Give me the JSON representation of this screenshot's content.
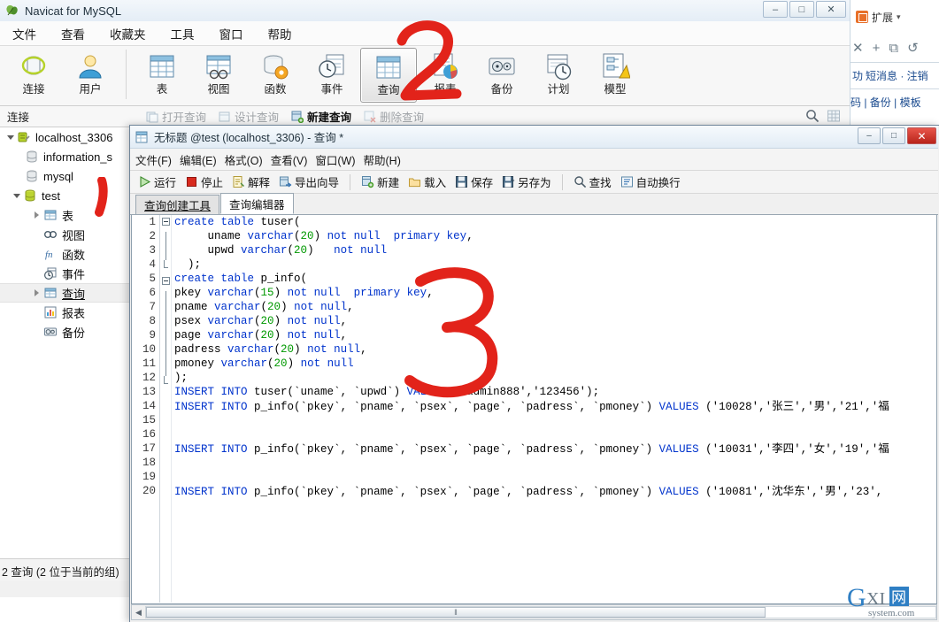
{
  "main_window": {
    "title": "Navicat for MySQL",
    "title_icon": "navicat-logo-icon",
    "window_buttons": {
      "minimize": "–",
      "maximize": "□",
      "close": "✕"
    },
    "menu": [
      {
        "label": "文件"
      },
      {
        "label": "查看"
      },
      {
        "label": "收藏夹"
      },
      {
        "label": "工具"
      },
      {
        "label": "窗口"
      },
      {
        "label": "帮助"
      }
    ],
    "toolbar": {
      "group1": [
        {
          "label": "连接",
          "icon": "connection-icon",
          "selected": false
        },
        {
          "label": "用户",
          "icon": "user-icon",
          "selected": false
        }
      ],
      "group2": [
        {
          "label": "表",
          "icon": "table-icon",
          "selected": false
        },
        {
          "label": "视图",
          "icon": "view-icon",
          "selected": false
        },
        {
          "label": "函数",
          "icon": "function-icon",
          "selected": false
        },
        {
          "label": "事件",
          "icon": "event-icon",
          "selected": false
        },
        {
          "label": "查询",
          "icon": "query-icon",
          "selected": true
        },
        {
          "label": "报表",
          "icon": "report-icon",
          "selected": false
        },
        {
          "label": "备份",
          "icon": "backup-icon",
          "selected": false
        },
        {
          "label": "计划",
          "icon": "schedule-icon",
          "selected": false
        },
        {
          "label": "模型",
          "icon": "model-icon",
          "selected": false
        }
      ]
    },
    "connection_bar": {
      "label": "连接",
      "actions": [
        {
          "label": "打开查询",
          "icon": "open-query-icon",
          "enabled": false
        },
        {
          "label": "设计查询",
          "icon": "design-query-icon",
          "enabled": false
        },
        {
          "label": "新建查询",
          "icon": "new-query-icon",
          "enabled": true
        },
        {
          "label": "删除查询",
          "icon": "delete-query-icon",
          "enabled": false
        }
      ],
      "right_icons": [
        {
          "name": "search-icon"
        },
        {
          "name": "grid-view-icon"
        }
      ]
    },
    "sidebar": {
      "items": [
        {
          "label": "localhost_3306",
          "icon": "server-icon",
          "indent": 0,
          "twisty": "open",
          "selected": false
        },
        {
          "label": "information_s",
          "icon": "database-gray-icon",
          "indent": 1,
          "twisty": "none",
          "selected": false
        },
        {
          "label": "mysql",
          "icon": "database-gray-icon",
          "indent": 1,
          "twisty": "none",
          "selected": false
        },
        {
          "label": "test",
          "icon": "database-green-icon",
          "indent": 0,
          "twisty": "open",
          "selected": false
        },
        {
          "label": "表",
          "icon": "table-icon",
          "indent": 2,
          "twisty": "closed",
          "selected": false
        },
        {
          "label": "视图",
          "icon": "view-icon",
          "indent": 2,
          "twisty": "none",
          "selected": false
        },
        {
          "label": "函数",
          "icon": "function-icon",
          "indent": 2,
          "twisty": "none",
          "selected": false
        },
        {
          "label": "事件",
          "icon": "event-icon",
          "indent": 2,
          "twisty": "none",
          "selected": false
        },
        {
          "label": "查询",
          "icon": "query-icon",
          "indent": 2,
          "twisty": "closed",
          "selected": true
        },
        {
          "label": "报表",
          "icon": "report-icon",
          "indent": 2,
          "twisty": "none",
          "selected": false
        },
        {
          "label": "备份",
          "icon": "backup-icon",
          "indent": 2,
          "twisty": "none",
          "selected": false
        }
      ]
    },
    "status_bar": {
      "text": "2 查询 (2 位于当前的组)"
    }
  },
  "query_window": {
    "title": "无标题 @test (localhost_3306) - 查询 *",
    "title_icon": "query-document-icon",
    "window_buttons": {
      "minimize": "–",
      "maximize": "□",
      "close": "✕"
    },
    "menu": [
      {
        "label": "文件(F)"
      },
      {
        "label": "编辑(E)"
      },
      {
        "label": "格式(O)"
      },
      {
        "label": "查看(V)"
      },
      {
        "label": "窗口(W)"
      },
      {
        "label": "帮助(H)"
      }
    ],
    "toolbar": [
      {
        "label": "运行",
        "icon": "run-icon"
      },
      {
        "label": "停止",
        "icon": "stop-icon"
      },
      {
        "label": "解释",
        "icon": "explain-icon"
      },
      {
        "label": "导出向导",
        "icon": "export-wizard-icon"
      },
      {
        "divider": true
      },
      {
        "label": "新建",
        "icon": "new-icon"
      },
      {
        "label": "载入",
        "icon": "load-icon"
      },
      {
        "label": "保存",
        "icon": "save-icon"
      },
      {
        "label": "另存为",
        "icon": "save-as-icon"
      },
      {
        "divider": true
      },
      {
        "label": "查找",
        "icon": "find-icon"
      },
      {
        "label": "自动换行",
        "icon": "word-wrap-icon"
      }
    ],
    "tabs": [
      {
        "label": "查询创建工具",
        "active": false
      },
      {
        "label": "查询编辑器",
        "active": true
      }
    ],
    "editor": {
      "lines": [
        {
          "n": 1,
          "fold": "start",
          "text": "create table tuser("
        },
        {
          "n": 2,
          "fold": "body",
          "text": "     uname varchar(20) not null  primary key,"
        },
        {
          "n": 3,
          "fold": "body",
          "text": "     upwd varchar(20)   not null"
        },
        {
          "n": 4,
          "fold": "end",
          "text": "  );"
        },
        {
          "n": 5,
          "fold": "start",
          "text": "create table p_info("
        },
        {
          "n": 6,
          "fold": "body",
          "text": "pkey varchar(15) not null  primary key,"
        },
        {
          "n": 7,
          "fold": "body",
          "text": "pname varchar(20) not null,"
        },
        {
          "n": 8,
          "fold": "body",
          "text": "psex varchar(20) not null,"
        },
        {
          "n": 9,
          "fold": "body",
          "text": "page varchar(20) not null,"
        },
        {
          "n": 10,
          "fold": "body",
          "text": "padress varchar(20) not null,"
        },
        {
          "n": 11,
          "fold": "body",
          "text": "pmoney varchar(20) not null"
        },
        {
          "n": 12,
          "fold": "end",
          "text": ");"
        },
        {
          "n": 13,
          "fold": "none",
          "text": "INSERT INTO tuser(`uname`, `upwd`) VALUES ('admin888','123456');"
        },
        {
          "n": 14,
          "fold": "none",
          "text": "INSERT INTO p_info(`pkey`, `pname`, `psex`, `page`, `padress`, `pmoney`) VALUES ('10028','张三','男','21','福"
        },
        {
          "n": 15,
          "fold": "none",
          "text": ""
        },
        {
          "n": 16,
          "fold": "none",
          "text": ""
        },
        {
          "n": 17,
          "fold": "none",
          "text": "INSERT INTO p_info(`pkey`, `pname`, `psex`, `page`, `padress`, `pmoney`) VALUES ('10031','李四','女','19','福"
        },
        {
          "n": 18,
          "fold": "none",
          "text": ""
        },
        {
          "n": 19,
          "fold": "none",
          "text": ""
        },
        {
          "n": 20,
          "fold": "none",
          "text": "INSERT INTO p_info(`pkey`, `pname`, `psex`, `page`, `padress`, `pmoney`) VALUES ('10081','沈华东','男','23',"
        }
      ]
    },
    "scrollbar": {
      "grip": "‖"
    }
  },
  "background_app": {
    "extension_label": "扩展",
    "caret": "▾",
    "nav_icons": [
      {
        "name": "close-tab-icon",
        "glyph": "✕"
      },
      {
        "name": "new-tab-icon",
        "glyph": "+"
      },
      {
        "name": "restore-tab-icon",
        "glyph": "⧉"
      },
      {
        "name": "reload-icon",
        "glyph": "↺"
      }
    ],
    "link_line_1": "短消息 · 注销",
    "link_line_1_prefix": "功",
    "link_line_2": "码 | 备份 | 模板"
  },
  "annotations": [
    {
      "name": "red-mark-2",
      "label": "2",
      "target": "query-toolbar-button"
    },
    {
      "name": "red-mark-3",
      "label": "3",
      "target": "sql-editor-area"
    },
    {
      "name": "red-mark-stroke",
      "label": "",
      "target": "sidebar-table-node"
    }
  ],
  "watermark": {
    "main": "GXI",
    "cjk": "网",
    "sub": "system.com"
  },
  "colors": {
    "accent_red": "#e2231a",
    "keyword_blue": "#0033cc",
    "number_green": "#009900",
    "titlebar_top": "#f6fafd",
    "titlebar_bottom": "#e2ecf5",
    "selection_gray": "#f0f0f0"
  }
}
